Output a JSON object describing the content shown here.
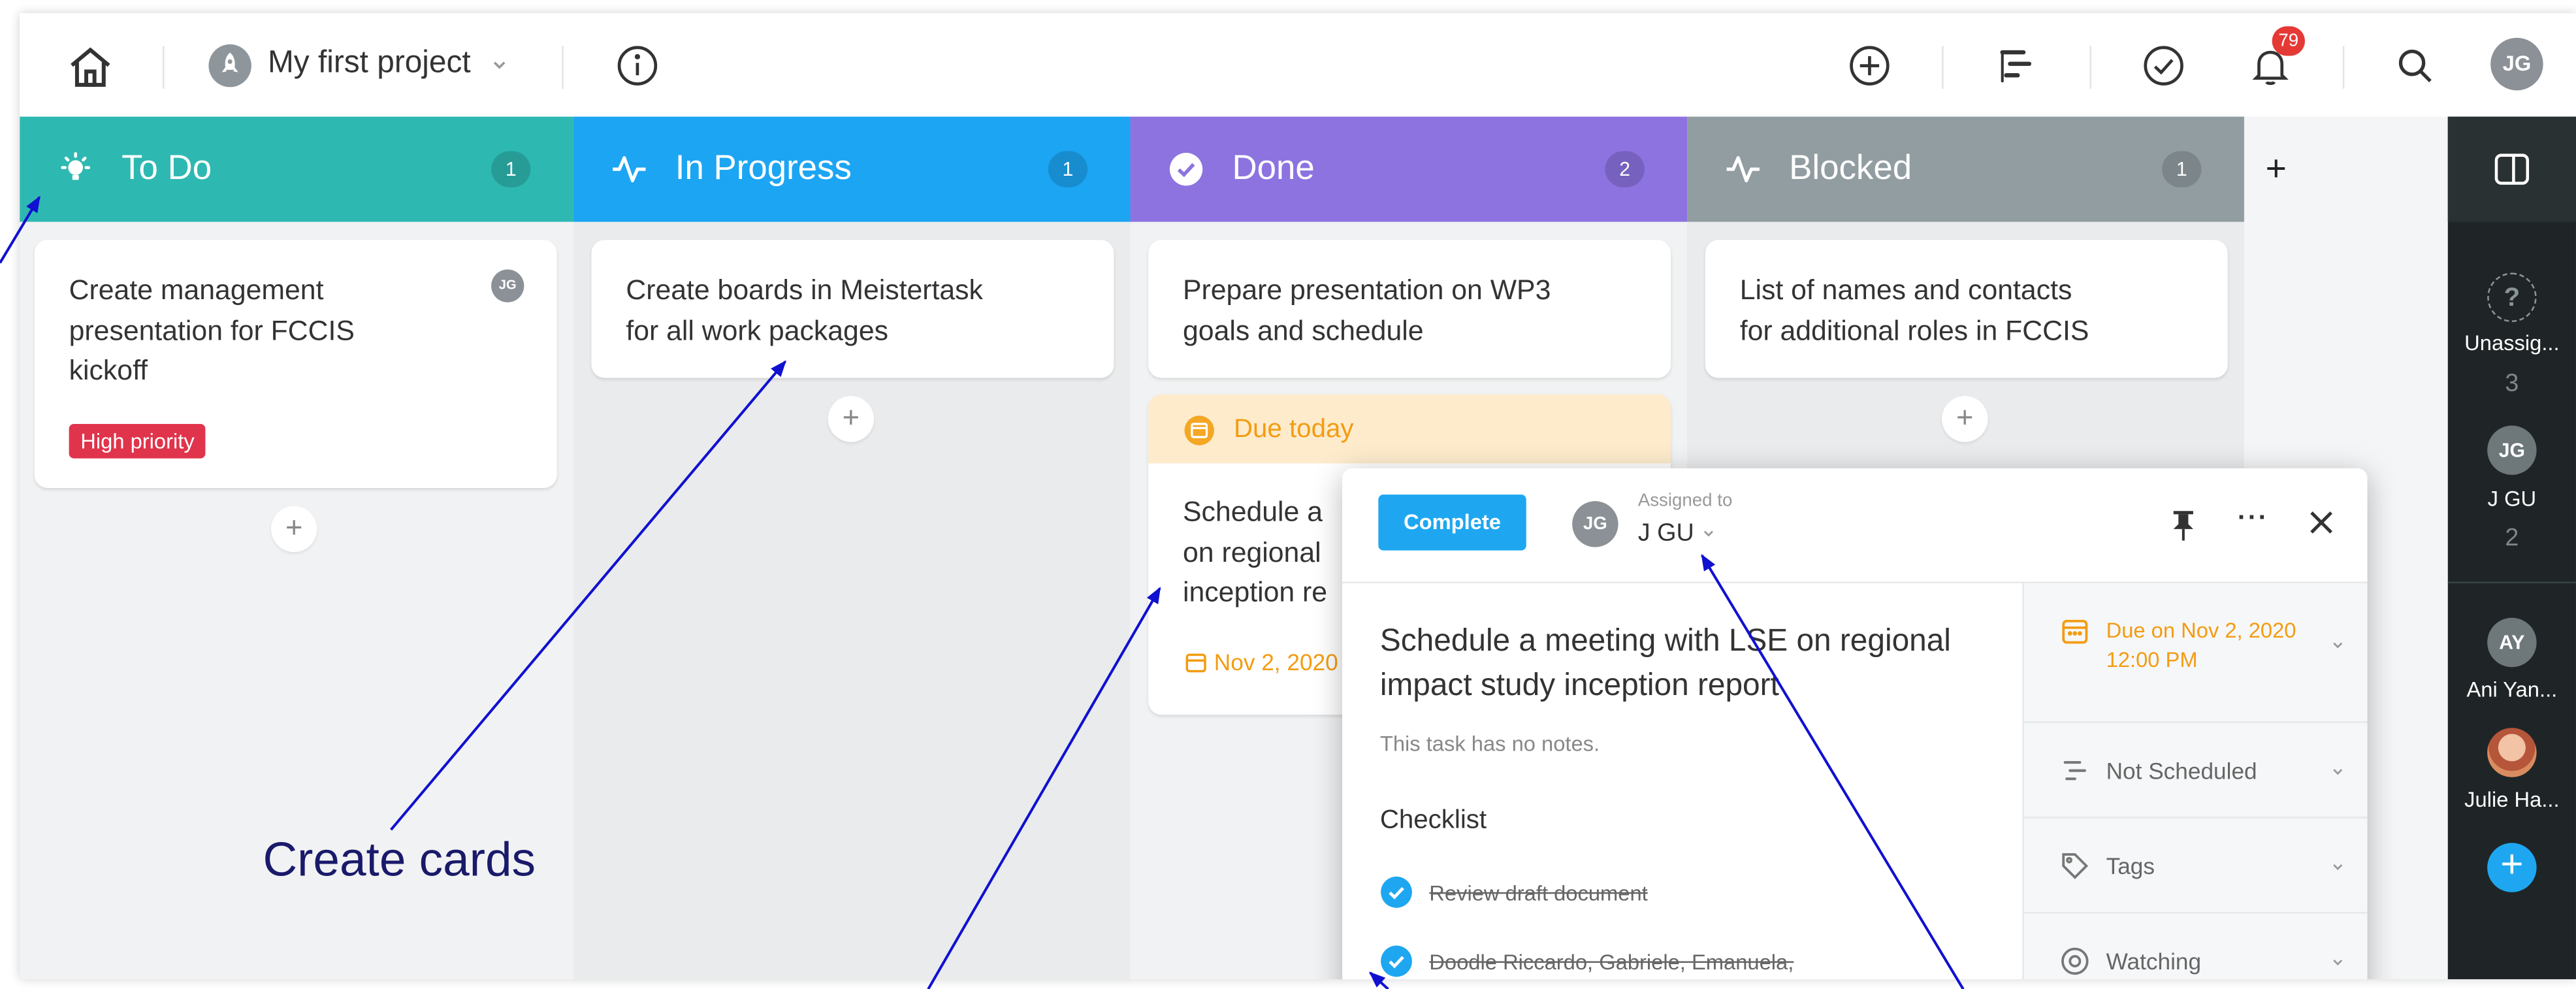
{
  "topbar": {
    "project_title": "My first project",
    "notification_count": "79",
    "user_initials": "JG"
  },
  "columns": [
    {
      "title": "To Do",
      "count": "1",
      "color": "#2eb8b2"
    },
    {
      "title": "In Progress",
      "count": "1",
      "color": "#1ca5f2"
    },
    {
      "title": "Done",
      "count": "2",
      "color": "#8c73e0"
    },
    {
      "title": "Blocked",
      "count": "1",
      "color": "#929da1"
    }
  ],
  "add_column_label": "+",
  "cards": {
    "todo": {
      "line1": "Create management",
      "line2": "presentation for FCCIS",
      "line3": "kickoff",
      "assignee": "JG",
      "badge": "High priority"
    },
    "progress": {
      "line1": "Create boards in Meistertask",
      "line2": "for all work packages"
    },
    "done": {
      "line1": "Prepare presentation on WP3",
      "line2": "goals and schedule"
    },
    "blocked": {
      "line1": "List of names and contacts",
      "line2": "for additional roles in FCCIS"
    },
    "due": {
      "header": "Due today",
      "line1": "Schedule a",
      "line2": "on regional",
      "line3": "inception re",
      "date": "Nov 2, 2020"
    }
  },
  "add_card_label": "+",
  "sidebar": {
    "unassigned_label": "Unassig...",
    "unassigned_count": "3",
    "user1_initials": "JG",
    "user1_label": "J GU",
    "user1_count": "2",
    "user2_initials": "AY",
    "user2_label": "Ani Yan...",
    "user3_label": "Julie Ha...",
    "add_label": "+"
  },
  "dialog": {
    "complete_label": "Complete",
    "assignee_initials": "JG",
    "assigned_caption": "Assigned to",
    "assigned_name": "J GU",
    "more_label": "···",
    "title": "Schedule a meeting with LSE on regional impact study inception report",
    "notes": "This task has no notes.",
    "checklist_title": "Checklist",
    "checklist": [
      {
        "text": "Review draft document",
        "done": true
      },
      {
        "text": "Doodle Riccardo, Gabriele, Emanuela, Irene, Johannes",
        "done": true
      }
    ],
    "due_line1": "Due on Nov 2, 2020",
    "due_line2": "12:00 PM",
    "schedule_label": "Not Scheduled",
    "tags_label": "Tags",
    "watching_label": "Watching"
  },
  "annotation": {
    "create_cards": "Create cards"
  },
  "colors": {
    "accent_blue": "#1ea7f0",
    "due_orange": "#f39c12",
    "priority_red": "#e0344c",
    "annotation_arrow": "#1010d0"
  }
}
